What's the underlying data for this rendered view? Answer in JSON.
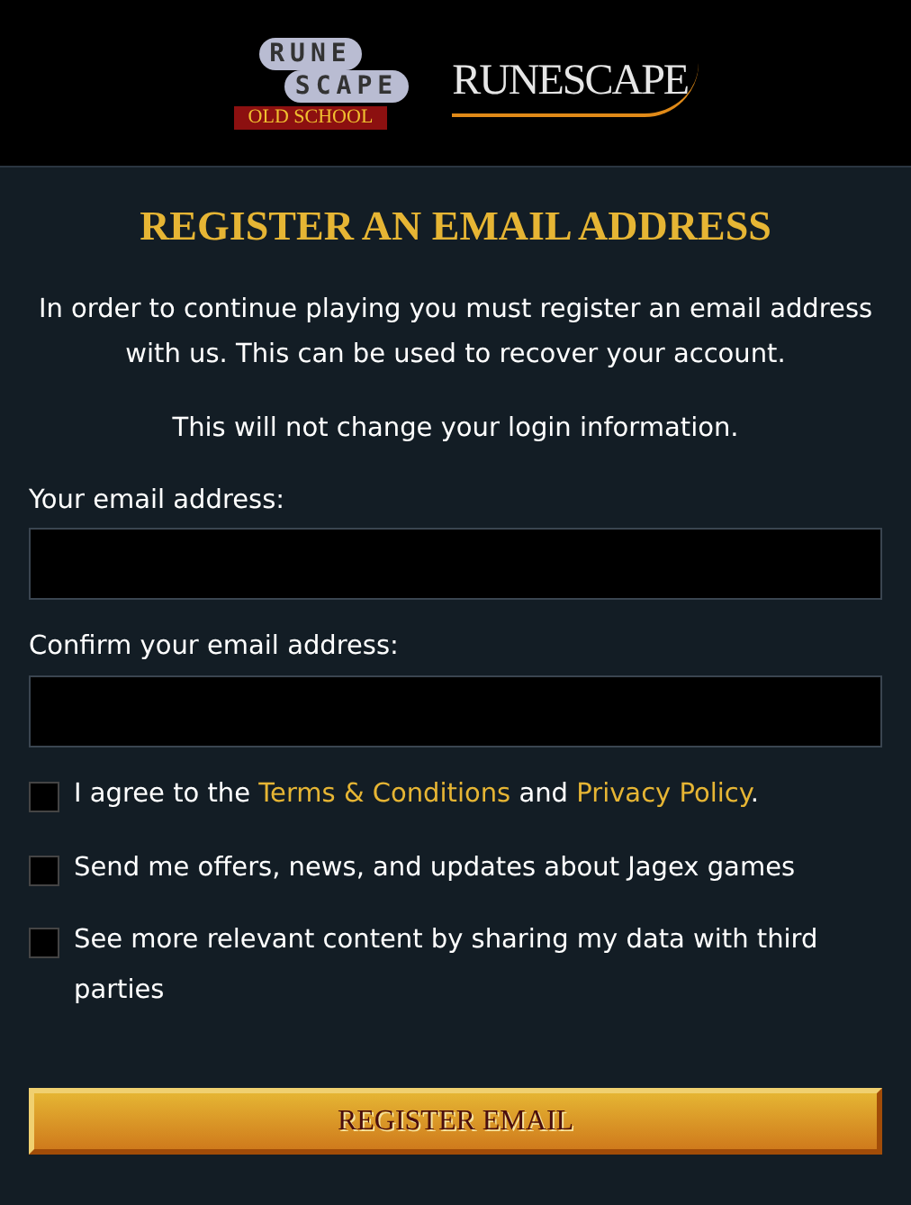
{
  "logos": [
    {
      "kind": "osrs",
      "words": [
        "RUNE",
        "SCAPE",
        "OLD SCHOOL"
      ]
    },
    {
      "kind": "rs",
      "words": [
        "RUNESCAPE"
      ]
    }
  ],
  "title": "REGISTER AN EMAIL ADDRESS",
  "paragraphs": [
    "In order to continue playing you must register an email address with us. This can be used to recover your account.",
    "This will not change your login information."
  ],
  "fields": [
    {
      "label": "Your email address:"
    },
    {
      "label": "Confirm your email address:"
    }
  ],
  "checkboxes": [
    {
      "checked": false,
      "parts": [
        {
          "text": "I agree to the "
        },
        {
          "text": "Terms & Conditions",
          "link": true
        },
        {
          "text": " and "
        },
        {
          "text": "Privacy Policy",
          "link": true
        },
        {
          "text": "."
        }
      ]
    },
    {
      "checked": false,
      "parts": [
        {
          "text": "Send me offers, news, and updates about Jagex games"
        }
      ]
    },
    {
      "checked": false,
      "parts": [
        {
          "text": "See more relevant content by sharing my data with third parties"
        }
      ]
    }
  ],
  "button": "REGISTER EMAIL"
}
